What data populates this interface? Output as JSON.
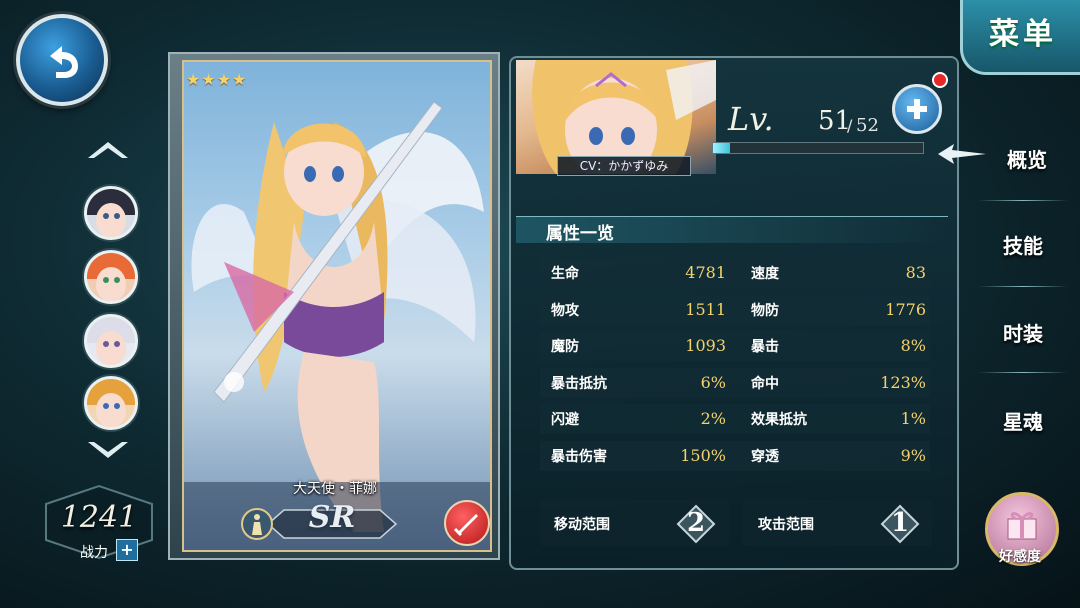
{
  "menu": {
    "label": "菜单"
  },
  "power": {
    "value": "1241",
    "label": "战力",
    "plus": "+"
  },
  "card": {
    "stars": "★★★★",
    "name": "大天使・菲娜",
    "rarity": "SR"
  },
  "character": {
    "cv": "CV：かかずゆみ",
    "level_label": "Lv.",
    "level": "51",
    "level_separator": "/",
    "level_max": "52",
    "exp_fraction": 0.08
  },
  "attributes": {
    "title": "属性一览",
    "rows": [
      {
        "left_name": "生命",
        "left_value": "4781",
        "right_name": "速度",
        "right_value": "83"
      },
      {
        "left_name": "物攻",
        "left_value": "1511",
        "right_name": "物防",
        "right_value": "1776"
      },
      {
        "left_name": "魔防",
        "left_value": "1093",
        "right_name": "暴击",
        "right_value": "8%"
      },
      {
        "left_name": "暴击抵抗",
        "left_value": "6%",
        "right_name": "命中",
        "right_value": "123%"
      },
      {
        "left_name": "闪避",
        "left_value": "2%",
        "right_name": "效果抵抗",
        "right_value": "1%"
      },
      {
        "left_name": "暴击伤害",
        "left_value": "150%",
        "right_name": "穿透",
        "right_value": "9%"
      }
    ]
  },
  "ranges": {
    "move_label": "移动范围",
    "move_value": "2",
    "attack_label": "攻击范围",
    "attack_value": "1"
  },
  "tabs": {
    "overview": "概览",
    "skills": "技能",
    "costume": "时装",
    "star_soul": "星魂",
    "affection": "好感度"
  },
  "colors": {
    "accent_gold": "#f4d36b",
    "panel": "#14343e",
    "button_blue": "#1c5e99"
  }
}
